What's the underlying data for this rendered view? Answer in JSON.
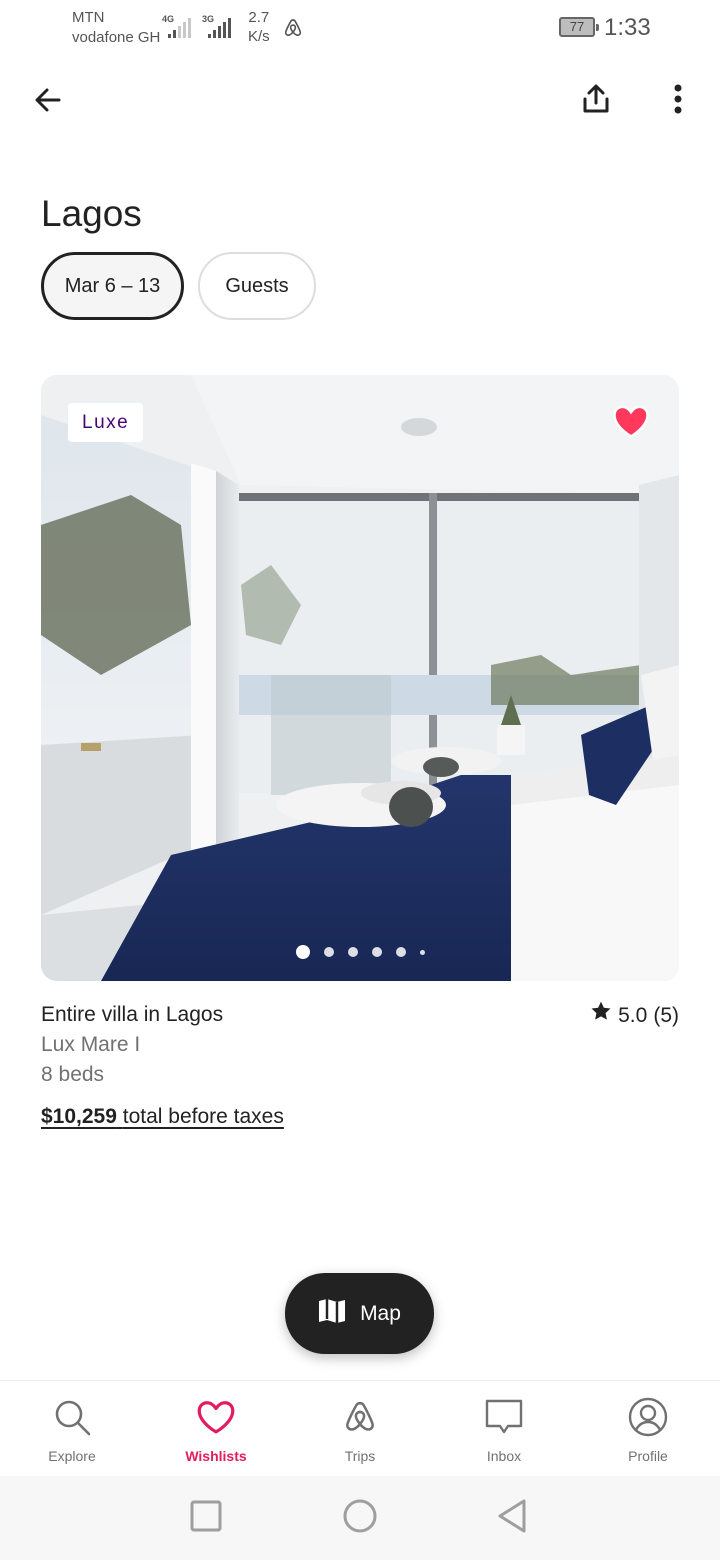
{
  "status_bar": {
    "carrier_1": "MTN",
    "carrier_2": "vodafone GH",
    "network_1": "4G",
    "network_2": "3G",
    "speed_value": "2.7",
    "speed_unit": "K/s",
    "battery": "77",
    "time": "1:33"
  },
  "header": {
    "back_icon": "arrow-left-icon",
    "share_icon": "share-icon",
    "more_icon": "more-vertical-icon"
  },
  "page": {
    "title": "Lagos"
  },
  "filters": {
    "dates": "Mar 6 – 13",
    "guests": "Guests"
  },
  "listing": {
    "badge": "Luxe",
    "favorited": true,
    "photo_count_dots": 6,
    "active_photo": 1,
    "type": "Entire villa in Lagos",
    "rating": "5.0",
    "reviews": "(5)",
    "name": "Lux Mare I",
    "beds": "8 beds",
    "price": "$10,259",
    "price_suffix": "total before taxes"
  },
  "map_button": {
    "label": "Map",
    "icon": "map-icon"
  },
  "tabs": [
    {
      "label": "Explore",
      "icon": "search-icon",
      "active": false
    },
    {
      "label": "Wishlists",
      "icon": "heart-icon",
      "active": true
    },
    {
      "label": "Trips",
      "icon": "airbnb-logo-icon",
      "active": false
    },
    {
      "label": "Inbox",
      "icon": "message-icon",
      "active": false
    },
    {
      "label": "Profile",
      "icon": "user-circle-icon",
      "active": false
    }
  ],
  "colors": {
    "brand": "#E31C5F",
    "luxe": "#460479",
    "favorite": "#FF385C",
    "text": "#222222",
    "secondary_text": "#717171"
  }
}
